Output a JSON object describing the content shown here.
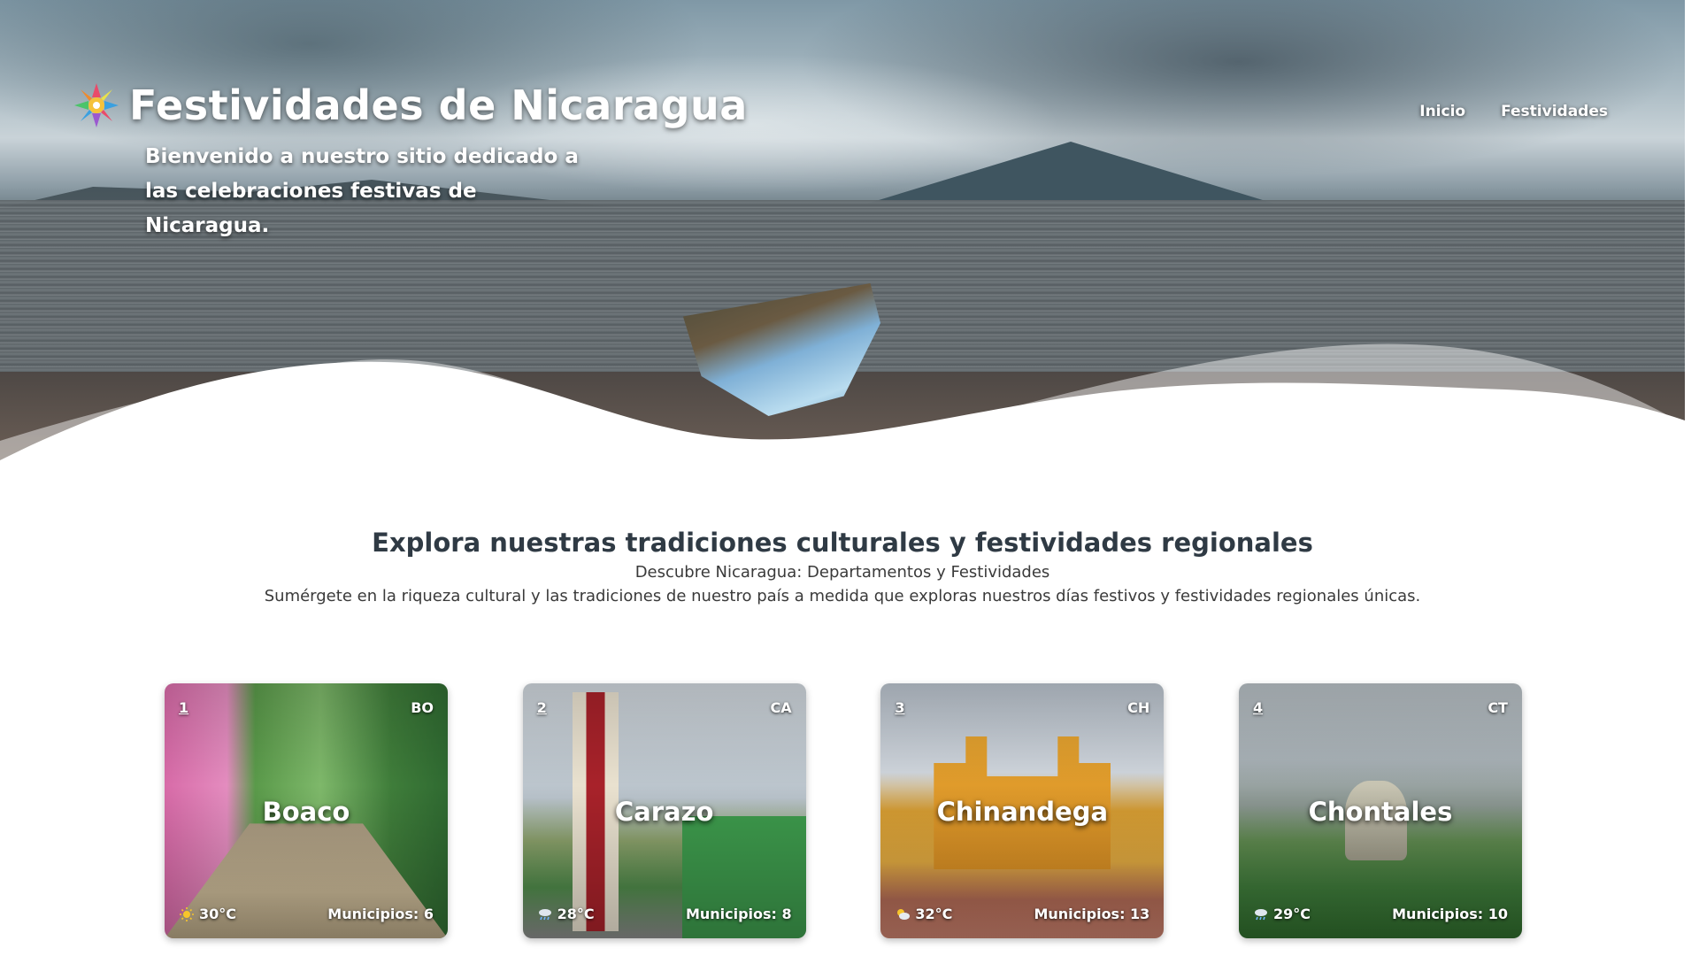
{
  "header": {
    "site_title": "Festividades de Nicaragua",
    "tagline": "Bienvenido a nuestro sitio dedicado a las celebraciones festivas de Nicaragua.",
    "nav": [
      {
        "label": "Inicio"
      },
      {
        "label": "Festividades"
      }
    ]
  },
  "intro": {
    "heading": "Explora nuestras tradiciones culturales y festividades regionales",
    "subheading": "Descubre Nicaragua: Departamentos y Festividades",
    "description": "Sumérgete en la riqueza cultural y las tradiciones de nuestro país a medida que exploras nuestros días festivos y festividades regionales únicas."
  },
  "cards": [
    {
      "number": "1",
      "code": "BO",
      "name": "Boaco",
      "temperature": "30°C",
      "weather_icon": "sun-icon",
      "municipios": "Municipios: 6"
    },
    {
      "number": "2",
      "code": "CA",
      "name": "Carazo",
      "temperature": "28°C",
      "weather_icon": "rain-cloud-icon",
      "municipios": "Municipios: 8"
    },
    {
      "number": "3",
      "code": "CH",
      "name": "Chinandega",
      "temperature": "32°C",
      "weather_icon": "partly-cloudy-icon",
      "municipios": "Municipios: 13"
    },
    {
      "number": "4",
      "code": "CT",
      "name": "Chontales",
      "temperature": "29°C",
      "weather_icon": "rain-cloud-icon",
      "municipios": "Municipios: 10"
    }
  ],
  "colors": {
    "heading_text": "#2f3a44",
    "body_text": "#3a3a3a",
    "hero_text": "#ffffff"
  }
}
